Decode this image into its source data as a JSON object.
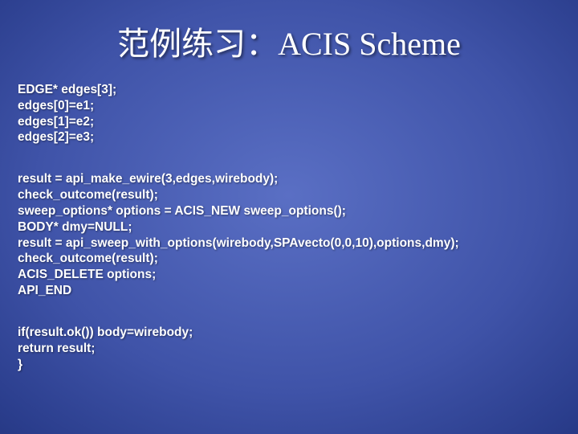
{
  "title": "范例练习：ACIS Scheme",
  "block1": "EDGE* edges[3];\nedges[0]=e1;\nedges[1]=e2;\nedges[2]=e3;",
  "block2": "result = api_make_ewire(3,edges,wirebody);\ncheck_outcome(result);\nsweep_options* options = ACIS_NEW sweep_options();\nBODY* dmy=NULL;\nresult = api_sweep_with_options(wirebody,SPAvecto(0,0,10),options,dmy);\ncheck_outcome(result);\nACIS_DELETE options;\nAPI_END",
  "block3": "if(result.ok()) body=wirebody;\nreturn result;\n}"
}
